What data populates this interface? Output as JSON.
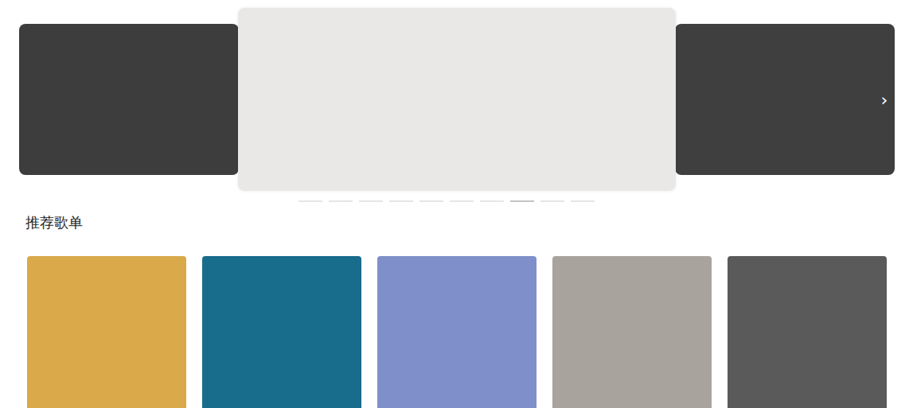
{
  "carousel": {
    "banners": [
      {
        "selected": false,
        "color": "#3d3d3d"
      },
      {
        "selected": true,
        "color": "#e9e8e6"
      },
      {
        "selected": false,
        "color": "#3f3f3f"
      }
    ],
    "next_arrow": "›",
    "dots": [
      {
        "selected": false
      },
      {
        "selected": false
      },
      {
        "selected": false
      },
      {
        "selected": false
      },
      {
        "selected": false
      },
      {
        "selected": false
      },
      {
        "selected": false
      },
      {
        "selected": true
      },
      {
        "selected": false
      },
      {
        "selected": false
      }
    ]
  },
  "section_title": "推荐歌单",
  "playlists": [
    {
      "color": "#d9a94a"
    },
    {
      "color": "#186c8c"
    },
    {
      "color": "#7f8fc9"
    },
    {
      "color": "#a9a39d"
    },
    {
      "color": "#5a5a5a"
    }
  ]
}
